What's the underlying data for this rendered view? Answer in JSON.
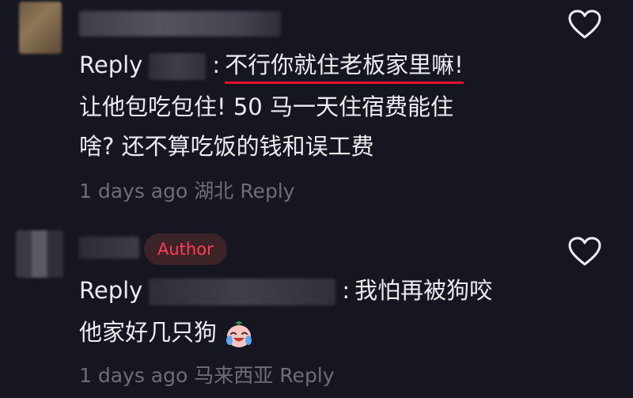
{
  "comments": [
    {
      "reply_label": "Reply",
      "colon": ":",
      "quote": "不行你就住老板家里嘛!",
      "line2": "让他包吃包住!  50 马一天住宿费能住",
      "line3": "啥? 还不算吃饭的钱和误工费",
      "time": "1 days ago",
      "location": "湖北",
      "reply_link": "Reply",
      "like_icon": "heart-outline-icon"
    },
    {
      "author_badge": "Author",
      "reply_label": "Reply",
      "colon": ":",
      "text1": "我怕再被狗咬",
      "text2": "他家好几只狗",
      "emoji": "crying-laughing-emoji",
      "time": "1 days ago",
      "location": "马来西亚",
      "reply_link": "Reply",
      "like_icon": "heart-outline-icon"
    }
  ],
  "colors": {
    "background": "#161620",
    "text": "#ececf0",
    "meta": "#6e6e78",
    "author_badge_text": "#ff3b55",
    "author_badge_bg": "#3b2327",
    "underline": "#e8102a"
  }
}
